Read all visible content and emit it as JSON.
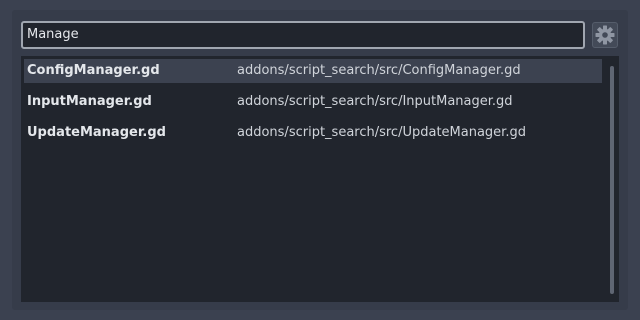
{
  "search": {
    "value": "Manage"
  },
  "settings_button": {
    "icon": "gear-icon"
  },
  "results": [
    {
      "name": "ConfigManager.gd",
      "path": "addons/script_search/src/ConfigManager.gd",
      "selected": true
    },
    {
      "name": "InputManager.gd",
      "path": "addons/script_search/src/InputManager.gd",
      "selected": false
    },
    {
      "name": "UpdateManager.gd",
      "path": "addons/script_search/src/UpdateManager.gd",
      "selected": false
    }
  ],
  "colors": {
    "background": "#3b4150",
    "panel": "#21252d",
    "selected_row": "#3c4250",
    "input_border": "#a0a6b0"
  }
}
